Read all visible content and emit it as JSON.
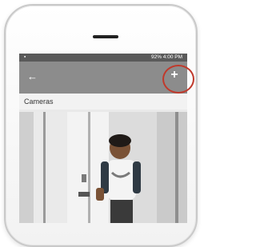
{
  "status_bar": {
    "left_icon": "image-icon",
    "right_text": "92% 4:00 PM"
  },
  "toolbar": {
    "back_icon": "arrow-left-icon",
    "add_icon": "plus-icon"
  },
  "highlight_color": "#c0392b",
  "section": {
    "label": "Cameras"
  },
  "camera_preview": {
    "scene": "camera-thumbnail"
  }
}
